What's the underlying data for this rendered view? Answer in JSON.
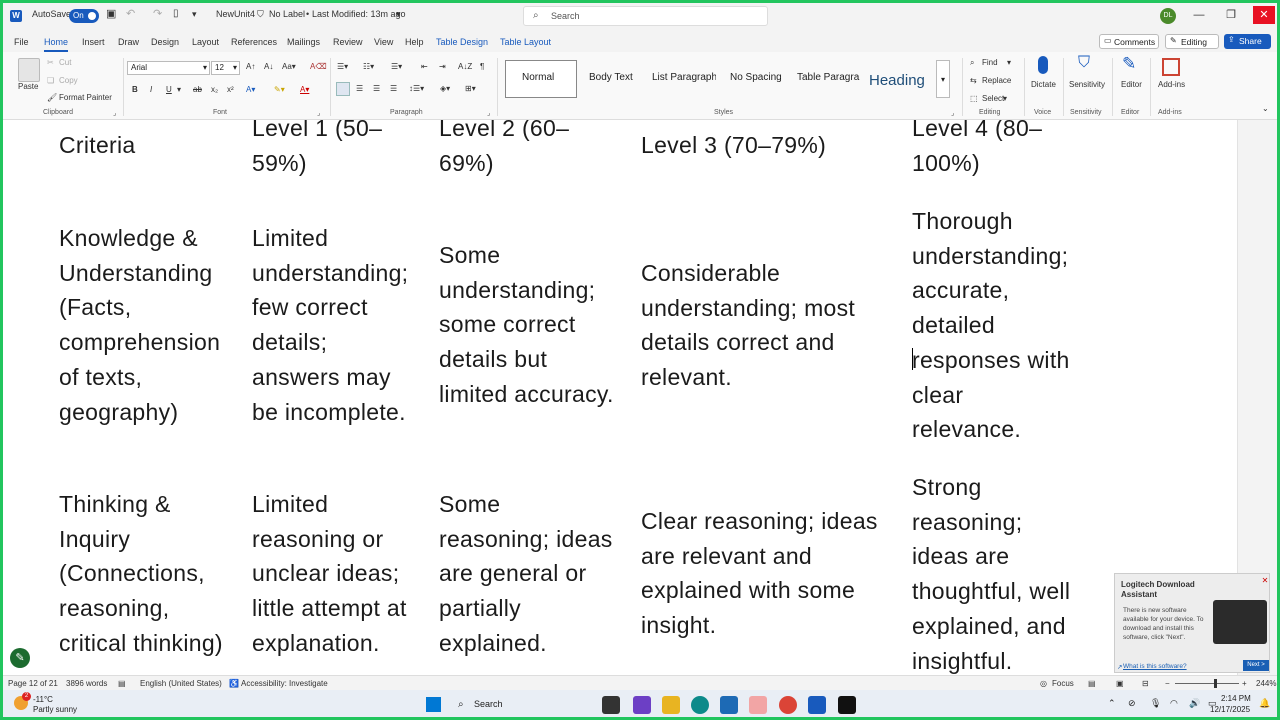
{
  "titlebar": {
    "autosave": "AutoSave",
    "autosave_state": "On",
    "docname": "NewUnit4",
    "label": "No Label",
    "modified": "Last Modified: 13m ago",
    "search_placeholder": "Search",
    "user_initials": "DL"
  },
  "menu": {
    "file": "File",
    "home": "Home",
    "insert": "Insert",
    "draw": "Draw",
    "design": "Design",
    "layout": "Layout",
    "references": "References",
    "mailings": "Mailings",
    "review": "Review",
    "view": "View",
    "help": "Help",
    "table_design": "Table Design",
    "table_layout": "Table Layout",
    "comments": "Comments",
    "editing": "Editing",
    "share": "Share"
  },
  "ribbon": {
    "paste": "Paste",
    "cut": "Cut",
    "copy": "Copy",
    "format_painter": "Format Painter",
    "clipboard": "Clipboard",
    "font_name": "Arial",
    "font_size": "12",
    "font": "Font",
    "paragraph": "Paragraph",
    "styles_label": "Styles",
    "styles": [
      "Normal",
      "Body Text",
      "List Paragraph",
      "No Spacing",
      "Table Paragra",
      "Heading"
    ],
    "find": "Find",
    "replace": "Replace",
    "select": "Select",
    "editing": "Editing",
    "dictate": "Dictate",
    "voice": "Voice",
    "sensitivity": "Sensitivity",
    "editor": "Editor",
    "addins": "Add-ins"
  },
  "table": {
    "header": [
      "Criteria",
      "Level 1 (50–\n59%)",
      "Level 2 (60–\n69%)",
      "Level 3 (70–79%)",
      "Level 4 (80–\n100%)"
    ],
    "rows": [
      [
        "Knowledge &\nUnderstanding\n(Facts,\ncomprehension\nof texts,\ngeography)",
        "Limited\nunderstanding;\nfew correct\ndetails;\nanswers may\nbe incomplete.",
        "Some\nunderstanding;\nsome correct\ndetails but\nlimited accuracy.",
        "Considerable\nunderstanding; most\ndetails correct and\nrelevant.",
        "Thorough\nunderstanding;\naccurate,\ndetailed\nresponses with\nclear\nrelevance."
      ],
      [
        "Thinking &\nInquiry\n(Connections,\nreasoning,\ncritical thinking)",
        "Limited\nreasoning or\nunclear ideas;\nlittle attempt at\nexplanation.",
        "Some\nreasoning; ideas\nare general or\npartially\nexplained.",
        "Clear reasoning; ideas\nare relevant and\nexplained with some\ninsight.",
        "Strong\nreasoning;\nideas are\nthoughtful, well\nexplained, and\ninsightful."
      ]
    ]
  },
  "toast": {
    "title": "Logitech Download Assistant",
    "body": "There is new software available for your device. To download and install this software, click \"Next\".",
    "link": "What is this software?",
    "next": "Next >"
  },
  "status": {
    "page": "Page 12 of 21",
    "words": "3896 words",
    "language": "English (United States)",
    "accessibility": "Accessibility: Investigate",
    "focus": "Focus",
    "zoom": "244%"
  },
  "taskbar": {
    "temp": "-11°C",
    "weather": "Partly sunny",
    "search": "Search",
    "time": "2:14 PM",
    "date": "12/17/2025",
    "badge": "2"
  }
}
